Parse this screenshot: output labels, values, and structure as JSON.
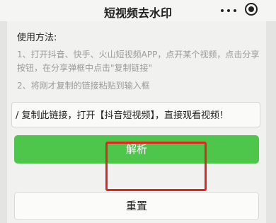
{
  "header": {
    "title": "短视频去水印",
    "more_icon": "more-dots-icon",
    "close_icon": "record-close-icon"
  },
  "instructions": {
    "heading": "使用方法:",
    "step1": "1、打开抖音、快手、火山短视频APP，点开某个视频，点击分享按钮，在分享弹框中点击\"复制链接\"",
    "step2": "2、将刚才复制的链接粘贴到输入框"
  },
  "link_input": {
    "value": "/ 复制此链接，打开【抖音短视频】，直接观看视频！"
  },
  "buttons": {
    "parse_label": "解析",
    "reset_label": "重置"
  },
  "colors": {
    "primary_green": "#4ec64c",
    "highlight_red": "#e0261f"
  }
}
